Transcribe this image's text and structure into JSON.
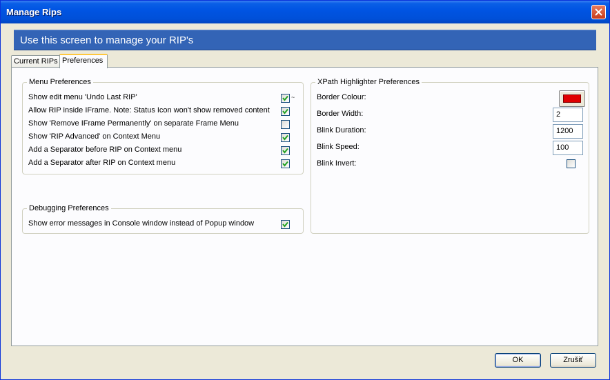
{
  "window": {
    "title": "Manage Rips",
    "close_icon": "close-x-icon"
  },
  "banner": {
    "text": "Use this screen to manage your RIP's"
  },
  "tabs": [
    {
      "label": "Current RIPs",
      "active": false
    },
    {
      "label": "Preferences",
      "active": true
    }
  ],
  "menu_prefs": {
    "title": "Menu Preferences",
    "items": [
      {
        "label": "Show edit menu 'Undo Last RIP'",
        "checked": true,
        "suffix": "~"
      },
      {
        "label": "Allow RIP inside IFrame.    Note: Status Icon won't show removed content",
        "checked": true
      },
      {
        "label": "Show 'Remove IFrame Permanently' on separate Frame Menu",
        "checked": false
      },
      {
        "label": "Show 'RIP Advanced' on Context Menu",
        "checked": true
      },
      {
        "label": "Add a Separator before RIP on Context menu",
        "checked": true
      },
      {
        "label": "Add a Separator after RIP on Context menu",
        "checked": true
      }
    ]
  },
  "debug_prefs": {
    "title": "Debugging Preferences",
    "items": [
      {
        "label": "Show error messages in Console window instead of Popup window",
        "checked": true
      }
    ]
  },
  "xpath_prefs": {
    "title": "XPath Highlighter Preferences",
    "border_colour_label": "Border Colour:",
    "border_colour": "#e00000",
    "border_width_label": "Border Width:",
    "border_width": "2",
    "blink_duration_label": "Blink Duration:",
    "blink_duration": "1200",
    "blink_speed_label": "Blink Speed:",
    "blink_speed": "100",
    "blink_invert_label": "Blink Invert:",
    "blink_invert": false
  },
  "buttons": {
    "ok": "OK",
    "cancel": "Zrušiť"
  },
  "colors": {
    "titlebar": "#0054e3",
    "banner": "#3364b6",
    "check": "#21a121"
  }
}
